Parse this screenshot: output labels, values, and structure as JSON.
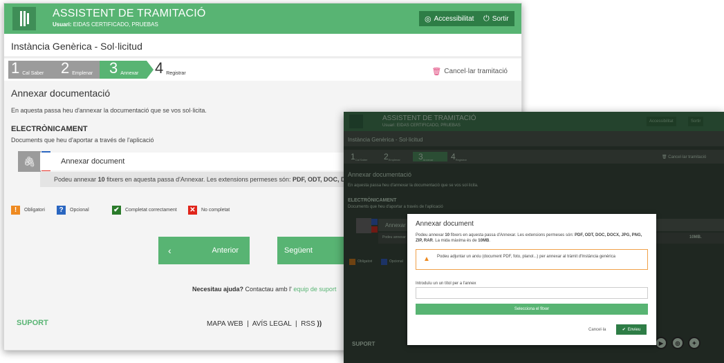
{
  "app": {
    "title": "ASSISTENT DE TRAMITACIÓ",
    "user_label": "Usuari:",
    "user_name": "EIDAS CERTIFICADO, PRUEBAS",
    "accessibility_label": "Accessibilitat",
    "logout_label": "Sortir"
  },
  "page": {
    "title": "Instància Genèrica - Sol·licitud",
    "cancel_label": "Cancel·lar tramitació",
    "section_title": "Annexar documentació",
    "section_desc": "En aquesta passa heu d'annexar la documentació que se vos sol·licita.",
    "electronic_title": "ELECTRÒNICAMENT",
    "electronic_desc": "Documents que heu d'aportar a través de l'aplicació"
  },
  "steps": [
    {
      "num": "1",
      "label": "Cal Saber"
    },
    {
      "num": "2",
      "label": "Emplenar"
    },
    {
      "num": "3",
      "label": "Annexar"
    },
    {
      "num": "4",
      "label": "Registrar"
    }
  ],
  "document": {
    "label": "Annexar document",
    "info_prefix": "Podeu annexar",
    "info_count": "10",
    "info_suffix": "fitxers en aquesta passa d'Annexar.  Les extensions permeses són:",
    "info_ext": "PDF, ODT, DOC, DC",
    "info_ext_front": "10MB."
  },
  "legend": {
    "mandatory": "Obligatori",
    "optional": "Opcional",
    "completed": "Completat correctament",
    "not_completed": "No completat"
  },
  "nav": {
    "prev_label": "Anterior",
    "next_label": "Següent"
  },
  "help": {
    "question": "Necesitau ajuda?",
    "text": "Contactau amb l'",
    "link": "equip de suport"
  },
  "footer": {
    "support": "SUPORT",
    "sitemap": "MAPA WEB",
    "legal": "AVÍS LEGAL",
    "rss": "RSS"
  },
  "modal": {
    "title": "Annexar document",
    "desc_prefix": "Podeu annexar",
    "desc_count": "10",
    "desc_mid": "fitxers en aquesta passa d'Annexar. Les extensions permeses són:",
    "desc_ext": "PDF, ODT, DOC, DOCX, JPG, PNG, ZIP, RAR",
    "desc_size_prefix": ". La mida màxima és de",
    "desc_size": "10MB",
    "warning": "Podeu adjuntar un arxiu (document PDF, foto, planol...) per annexar al tràmit d'Instància genèrica",
    "input_label": "Introduïu un un títol per a l'annex",
    "input_value": "",
    "select_label": "Selecciona el fitxer",
    "cancel_label": "Cancel·la",
    "send_label": "Envieu"
  },
  "colors": {
    "brand_green": "#58b473",
    "dark_green": "#2e7d46",
    "optional_blue": "#2a66c0",
    "error_red": "#e0251b",
    "mandatory_orange": "#ee8a21"
  }
}
